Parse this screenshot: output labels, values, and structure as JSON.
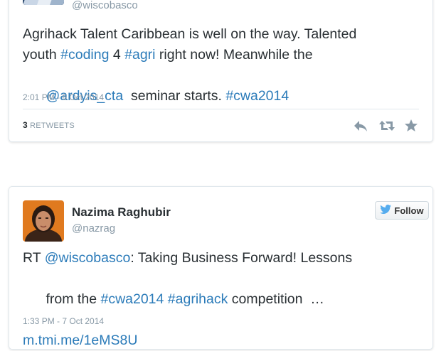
{
  "tweet1": {
    "handle": "@wiscobasco",
    "text_part1": "Agrihack Talent Caribbean is well on the way. Talented",
    "text_part2": "youth ",
    "hashtag_coding": "#coding",
    "text_part3": " 4 ",
    "hashtag_agri": "#agri",
    "text_part4": " right now! Meanwhile the",
    "mention_ardyis": "@ardyis_cta",
    "text_part5": "  seminar starts. ",
    "hashtag_cwa2014": "#cwa2014",
    "timestamp": "2:01 PM - 6 Oct 2014",
    "retweet_count": "3",
    "retweet_label": "RETWEETS"
  },
  "tweet2": {
    "name": "Nazima Raghubir",
    "handle": "@nazrag",
    "follow_label": "Follow",
    "text_prefix": "RT ",
    "mention_wiscobasco": "@wiscobasco",
    "text_part1": ": Taking Business Forward! Lessons",
    "text_part2": "from the ",
    "hashtag_cwa2014": "#cwa2014",
    "text_space": " ",
    "hashtag_agrihack": "#agrihack",
    "text_part3": " competition  …",
    "link": "m.tmi.me/1eMS8U",
    "timestamp": "1:33 PM - 7 Oct 2014"
  },
  "colors": {
    "link": "#2b7bb9",
    "muted": "#8899a6",
    "text": "#292f33",
    "twitter_blue": "#55acee"
  },
  "icons": [
    "reply-icon",
    "retweet-icon",
    "favorite-icon",
    "twitter-bird-icon"
  ]
}
